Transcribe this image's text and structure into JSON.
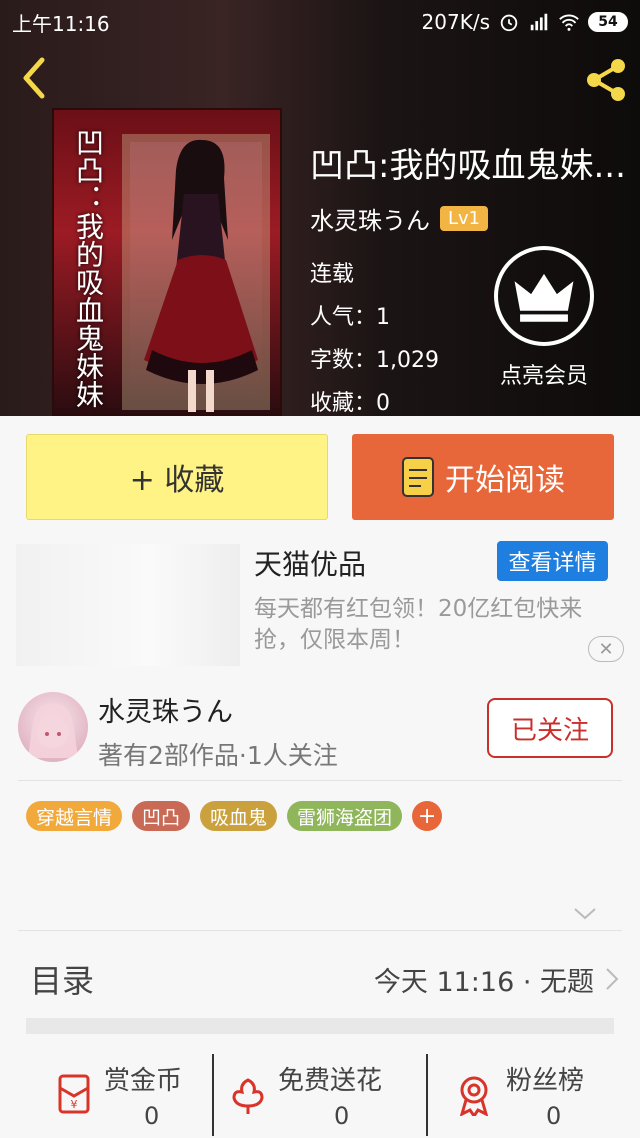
{
  "status_bar": {
    "time": "上午11:16",
    "net_speed": "207K/s",
    "battery": "54"
  },
  "book": {
    "title": "凹凸:我的吸血鬼妹...",
    "author": "水灵珠うん",
    "author_level": "Lv1",
    "status": "连载",
    "popularity": "人气：1",
    "word_count": "字数：1,029",
    "favorites": "收藏：0",
    "cover_text": "凹凸：我的吸血鬼妹妹"
  },
  "vip": {
    "label": "点亮会员"
  },
  "actions": {
    "collect": "+ 收藏",
    "read": "开始阅读"
  },
  "ad": {
    "title": "天猫优品",
    "detail_button": "查看详情",
    "description": "每天都有红包领！20亿红包快来抢，仅限本周！"
  },
  "author_card": {
    "name": "水灵珠うん",
    "stats": "著有2部作品·1人关注",
    "follow_button": "已关注"
  },
  "tags": [
    {
      "label": "穿越言情",
      "color": "#f2a93b"
    },
    {
      "label": "凹凸",
      "color": "#c96a57"
    },
    {
      "label": "吸血鬼",
      "color": "#caa13d"
    },
    {
      "label": "雷狮海盗团",
      "color": "#8fb65b"
    }
  ],
  "toc": {
    "title": "目录",
    "latest": "今天 11:16 · 无题"
  },
  "bottom_stats": [
    {
      "label": "赏金币",
      "value": "0",
      "icon": "red-envelope-icon"
    },
    {
      "label": "免费送花",
      "value": "0",
      "icon": "flower-icon"
    },
    {
      "label": "粉丝榜",
      "value": "0",
      "icon": "medal-icon"
    }
  ],
  "colors": {
    "accent_orange": "#e8673a",
    "collect_yellow": "#fff385",
    "follow_red": "#c9302c",
    "ad_blue": "#1e7fe0"
  }
}
